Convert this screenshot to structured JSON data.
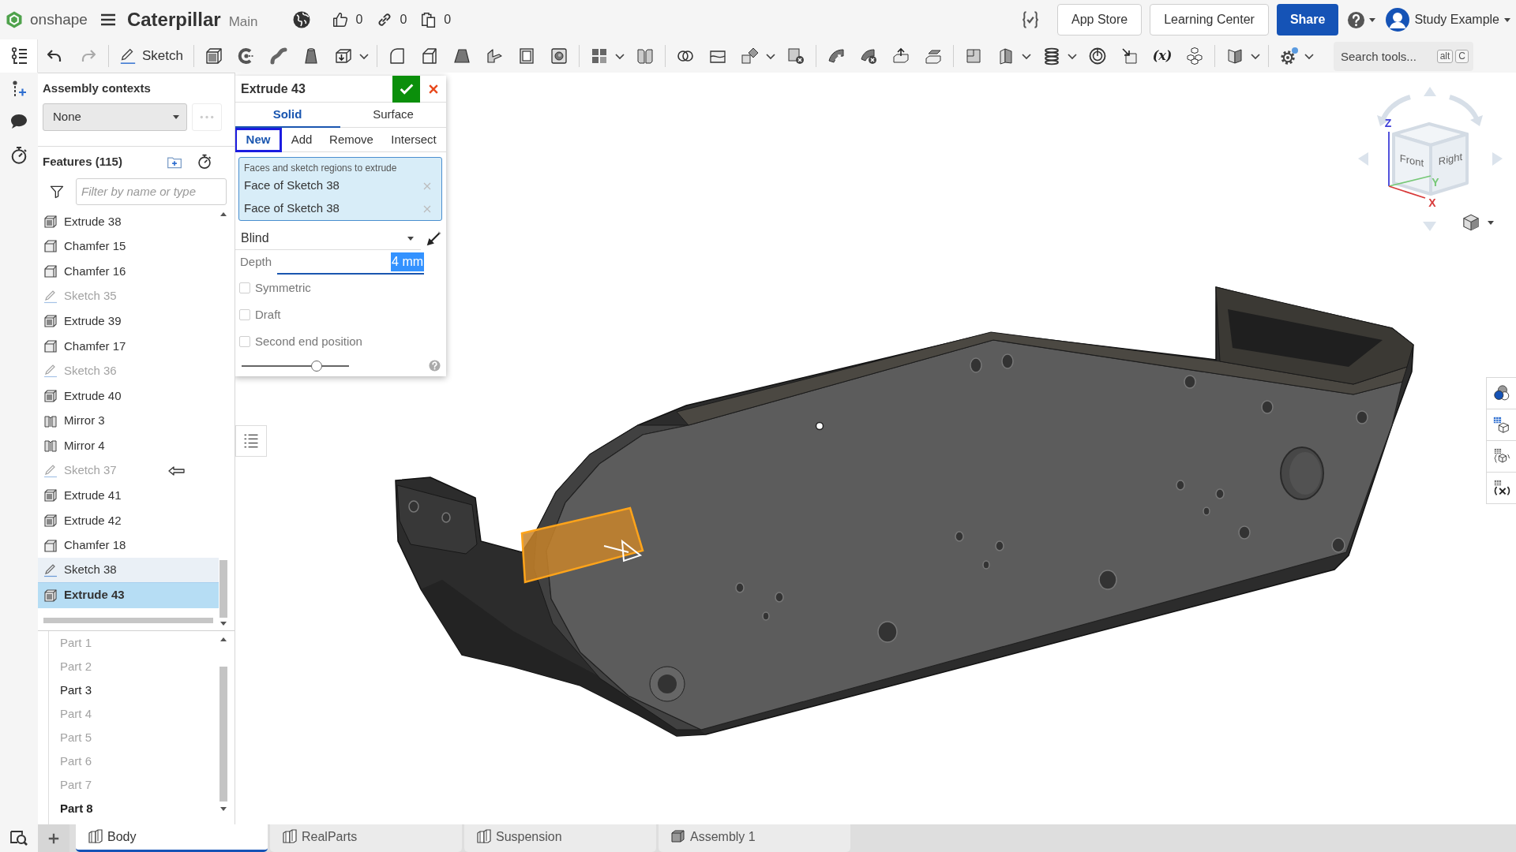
{
  "header": {
    "brand": "onshape",
    "document_title": "Caterpillar",
    "branch": "Main",
    "counters": [
      {
        "kind": "likes",
        "value": "0"
      },
      {
        "kind": "links",
        "value": "0"
      },
      {
        "kind": "copies",
        "value": "0"
      }
    ],
    "buttons": [
      {
        "label": "App Store",
        "kind": "outline"
      },
      {
        "label": "Learning Center",
        "kind": "outline"
      },
      {
        "label": "Share",
        "kind": "primary"
      }
    ],
    "user": "Study Example"
  },
  "toolbar": {
    "sketch_label": "Sketch",
    "variable_label": "(x)",
    "search": {
      "placeholder": "Search tools...",
      "keys": [
        "alt",
        "C"
      ]
    }
  },
  "assembly_contexts": {
    "title": "Assembly contexts",
    "value": "None"
  },
  "features": {
    "title": "Features (115)",
    "filter_placeholder": "Filter by name or type",
    "items": [
      {
        "kind": "extrude",
        "label": "Extrude 38",
        "dimmed": false,
        "highlighted": false,
        "selected": false,
        "arrow": false
      },
      {
        "kind": "chamfer",
        "label": "Chamfer 15",
        "dimmed": false,
        "highlighted": false,
        "selected": false,
        "arrow": false
      },
      {
        "kind": "chamfer",
        "label": "Chamfer 16",
        "dimmed": false,
        "highlighted": false,
        "selected": false,
        "arrow": false
      },
      {
        "kind": "sketch",
        "label": "Sketch 35",
        "dimmed": true,
        "highlighted": false,
        "selected": false,
        "arrow": false
      },
      {
        "kind": "extrude",
        "label": "Extrude 39",
        "dimmed": false,
        "highlighted": false,
        "selected": false,
        "arrow": false
      },
      {
        "kind": "chamfer",
        "label": "Chamfer 17",
        "dimmed": false,
        "highlighted": false,
        "selected": false,
        "arrow": false
      },
      {
        "kind": "sketch",
        "label": "Sketch 36",
        "dimmed": true,
        "highlighted": false,
        "selected": false,
        "arrow": false
      },
      {
        "kind": "extrude",
        "label": "Extrude 40",
        "dimmed": false,
        "highlighted": false,
        "selected": false,
        "arrow": false
      },
      {
        "kind": "mirror",
        "label": "Mirror 3",
        "dimmed": false,
        "highlighted": false,
        "selected": false,
        "arrow": false
      },
      {
        "kind": "mirror",
        "label": "Mirror 4",
        "dimmed": false,
        "highlighted": false,
        "selected": false,
        "arrow": false
      },
      {
        "kind": "sketch",
        "label": "Sketch 37",
        "dimmed": true,
        "highlighted": false,
        "selected": false,
        "arrow": true
      },
      {
        "kind": "extrude",
        "label": "Extrude 41",
        "dimmed": false,
        "highlighted": false,
        "selected": false,
        "arrow": false
      },
      {
        "kind": "extrude",
        "label": "Extrude 42",
        "dimmed": false,
        "highlighted": false,
        "selected": false,
        "arrow": false
      },
      {
        "kind": "chamfer",
        "label": "Chamfer 18",
        "dimmed": false,
        "highlighted": false,
        "selected": false,
        "arrow": false
      },
      {
        "kind": "sketch",
        "label": "Sketch 38",
        "dimmed": false,
        "highlighted": true,
        "selected": false,
        "arrow": false
      },
      {
        "kind": "extrude",
        "label": "Extrude 43",
        "dimmed": false,
        "highlighted": false,
        "selected": true,
        "arrow": false
      }
    ]
  },
  "parts": [
    {
      "label": "Part 1",
      "dimmed": true,
      "selected": false
    },
    {
      "label": "Part 2",
      "dimmed": true,
      "selected": false
    },
    {
      "label": "Part 3",
      "dimmed": false,
      "selected": false
    },
    {
      "label": "Part 4",
      "dimmed": true,
      "selected": false
    },
    {
      "label": "Part 5",
      "dimmed": true,
      "selected": false
    },
    {
      "label": "Part 6",
      "dimmed": true,
      "selected": false
    },
    {
      "label": "Part 7",
      "dimmed": true,
      "selected": false
    },
    {
      "label": "Part 8",
      "dimmed": false,
      "selected": true
    }
  ],
  "feature_dialog": {
    "title": "Extrude 43",
    "body_types": [
      {
        "label": "Solid",
        "selected": true
      },
      {
        "label": "Surface",
        "selected": false
      }
    ],
    "operations": [
      {
        "label": "New",
        "selected": true
      },
      {
        "label": "Add",
        "selected": false
      },
      {
        "label": "Remove",
        "selected": false
      },
      {
        "label": "Intersect",
        "selected": false
      }
    ],
    "selection": {
      "caption": "Faces and sketch regions to extrude",
      "items": [
        "Face of Sketch 38",
        "Face of Sketch 38"
      ]
    },
    "end_type": "Blind",
    "depth": {
      "label": "Depth",
      "value": "4 mm",
      "text_selected": true
    },
    "options": [
      {
        "label": "Symmetric",
        "checked": false
      },
      {
        "label": "Draft",
        "checked": false
      },
      {
        "label": "Second end position",
        "checked": false
      }
    ],
    "slider": {
      "level": 0.7
    }
  },
  "view_cube": {
    "faces": [
      "Front",
      "Right"
    ],
    "axes": [
      {
        "label": "Z",
        "color": "#4040d8"
      },
      {
        "label": "Y",
        "color": "#77c877"
      },
      {
        "label": "X",
        "color": "#d83a3a"
      }
    ]
  },
  "tabs": [
    {
      "label": "Body",
      "kind": "part_studio",
      "selected": true
    },
    {
      "label": "RealParts",
      "kind": "part_studio",
      "selected": false
    },
    {
      "label": "Suspension",
      "kind": "part_studio",
      "selected": false
    },
    {
      "label": "Assembly 1",
      "kind": "assembly",
      "selected": false
    }
  ]
}
